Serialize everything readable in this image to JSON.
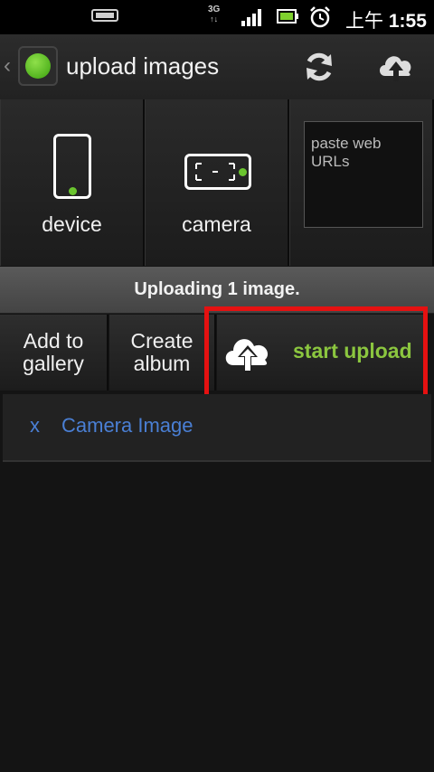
{
  "status_bar": {
    "network": "3G",
    "time_prefix": "上午",
    "time": "1:55",
    "icons": [
      "phone-icon",
      "signal-icon",
      "battery-icon",
      "alarm-icon"
    ]
  },
  "action_bar": {
    "title": "upload images",
    "icons": [
      "back-icon",
      "app-icon",
      "refresh-icon",
      "cloud-upload-icon"
    ]
  },
  "sources": {
    "device_label": "device",
    "camera_label": "camera",
    "urls_placeholder": "paste web URLs"
  },
  "banner": {
    "text": "Uploading 1 image."
  },
  "actions": {
    "add_to_gallery": "Add to gallery",
    "create_album": "Create album",
    "start_upload": "start upload"
  },
  "uploads": [
    {
      "remove": "x",
      "name": "Camera Image"
    }
  ],
  "colors": {
    "accent_green": "#8bc63f",
    "link_blue": "#4a7fd4",
    "highlight_red": "#e51111"
  }
}
